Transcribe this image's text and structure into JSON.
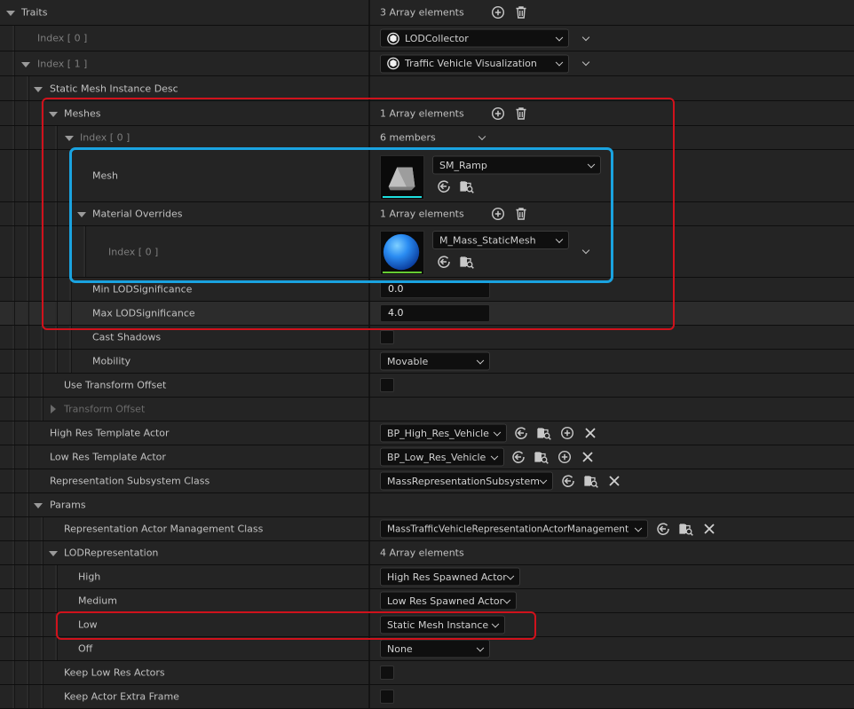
{
  "traits": {
    "label": "Traits",
    "count": "3 Array elements",
    "items": [
      {
        "index": "Index [ 0 ]",
        "value": "LODCollector"
      },
      {
        "index": "Index [ 1 ]",
        "value": "Traffic Vehicle Visualization"
      }
    ]
  },
  "smid": {
    "label": "Static Mesh Instance Desc",
    "meshes": {
      "label": "Meshes",
      "count": "1 Array elements",
      "index0": {
        "label": "Index [ 0 ]",
        "members": "6 members"
      },
      "mesh": {
        "label": "Mesh",
        "value": "SM_Ramp"
      },
      "material_overrides": {
        "label": "Material Overrides",
        "count": "1 Array elements",
        "index0": {
          "label": "Index [ 0 ]",
          "value": "M_Mass_StaticMesh"
        }
      },
      "min_lod": {
        "label": "Min LODSignificance",
        "value": "0.0"
      },
      "max_lod": {
        "label": "Max LODSignificance",
        "value": "4.0"
      },
      "cast_shadows": {
        "label": "Cast Shadows"
      },
      "mobility": {
        "label": "Mobility",
        "value": "Movable"
      }
    },
    "use_transform_offset": {
      "label": "Use Transform Offset"
    },
    "transform_offset": {
      "label": "Transform Offset"
    }
  },
  "high_res_template": {
    "label": "High Res Template Actor",
    "value": "BP_High_Res_Vehicle"
  },
  "low_res_template": {
    "label": "Low Res Template Actor",
    "value": "BP_Low_Res_Vehicle"
  },
  "rep_subsystem": {
    "label": "Representation Subsystem Class",
    "value": "MassRepresentationSubsystem"
  },
  "params": {
    "label": "Params",
    "rep_actor_mgmt": {
      "label": "Representation Actor Management Class",
      "value": "MassTrafficVehicleRepresentationActorManagement"
    },
    "lod_rep": {
      "label": "LODRepresentation",
      "count": "4 Array elements",
      "high": {
        "label": "High",
        "value": "High Res Spawned Actor"
      },
      "medium": {
        "label": "Medium",
        "value": "Low Res Spawned Actor"
      },
      "low": {
        "label": "Low",
        "value": "Static Mesh Instance"
      },
      "off": {
        "label": "Off",
        "value": "None"
      }
    },
    "keep_low_res_actors": {
      "label": "Keep Low Res Actors"
    },
    "keep_actor_extra_frame": {
      "label": "Keep Actor Extra Frame"
    }
  },
  "colors": {
    "panel": "#242424",
    "hover_row": "#2c2c2c",
    "highlight_red": "#d0121c",
    "highlight_blue": "#1aa3e0",
    "mesh_bar": "#1ee0e0",
    "material_bar": "#66cc33"
  }
}
